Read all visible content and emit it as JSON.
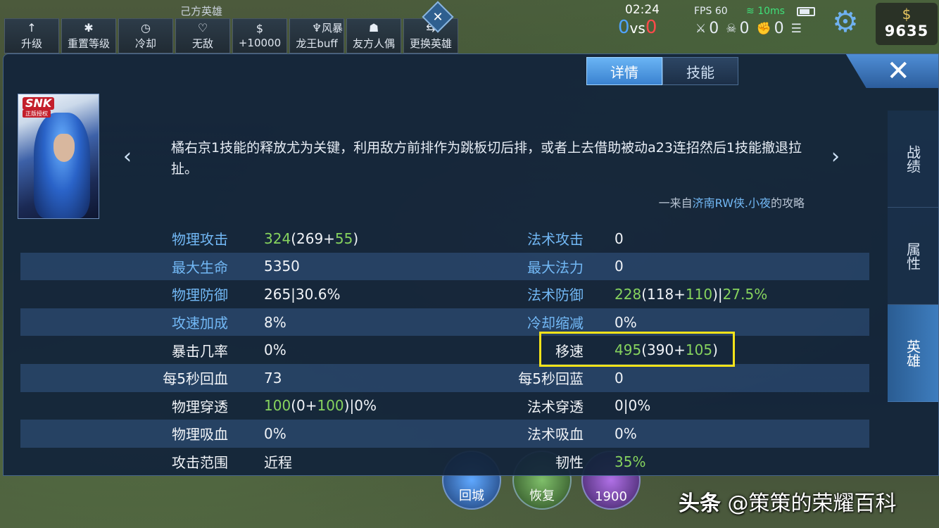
{
  "top_bar": {
    "side_label": "己方英雄",
    "buttons": [
      {
        "icon": "arrow-up-icon",
        "glyph": "↑",
        "label": "升级"
      },
      {
        "icon": "gear-icon",
        "glyph": "✱",
        "label": "重置等级"
      },
      {
        "icon": "clock-icon",
        "glyph": "◷",
        "label": "冷却"
      },
      {
        "icon": "heart-icon",
        "glyph": "♡",
        "label": "无敌"
      },
      {
        "icon": "coin-icon",
        "glyph": "$",
        "label": "+10000"
      },
      {
        "icon": "dragon-icon",
        "glyph": "♆",
        "label": "风暴",
        "label2": "龙王buff"
      },
      {
        "icon": "friend-icon",
        "glyph": "☗",
        "label": "友方人偶"
      },
      {
        "icon": "swap-icon",
        "glyph": "⇆",
        "label": "更换英雄"
      }
    ],
    "timer": "02:24",
    "score": {
      "blue": "0",
      "vs": "vs",
      "red": "0"
    },
    "fps": "FPS 60",
    "ping": "10ms",
    "kda": {
      "kills": "0",
      "deaths": "0",
      "assists": "0"
    },
    "gold": "9635"
  },
  "panel": {
    "tabs": [
      "详情",
      "技能"
    ],
    "active_tab": 0,
    "side_tabs": [
      "战绩",
      "属性",
      "英雄"
    ],
    "active_side_tab": 2,
    "portrait_badge": "SNK",
    "portrait_badge_sub": "正版授权",
    "tip": "橘右京1技能的释放尤为关键，利用敌方前排作为跳板切后排，或者上去借助被动a23连招然后1技能撤退拉扯。",
    "source_prefix": "一来自",
    "source_author": "济南RW侠.小夜",
    "source_suffix": "的攻略"
  },
  "stats": {
    "left": [
      {
        "label": "物理攻击",
        "label_color": "blue",
        "v1": "324",
        "v2": "(269+",
        "v3": "55",
        "v4": ")"
      },
      {
        "label": "最大生命",
        "label_color": "blue",
        "v1": "",
        "v2": "5350",
        "v3": "",
        "v4": ""
      },
      {
        "label": "物理防御",
        "label_color": "blue",
        "v1": "",
        "v2": "265|30.6%",
        "v3": "",
        "v4": ""
      },
      {
        "label": "攻速加成",
        "label_color": "blue",
        "v1": "",
        "v2": "8%",
        "v3": "",
        "v4": ""
      },
      {
        "label": "暴击几率",
        "label_color": "white",
        "v1": "",
        "v2": "0%",
        "v3": "",
        "v4": ""
      },
      {
        "label": "每5秒回血",
        "label_color": "white",
        "v1": "",
        "v2": "73",
        "v3": "",
        "v4": ""
      },
      {
        "label": "物理穿透",
        "label_color": "white",
        "v1": "100",
        "v2": "(0+",
        "v3": "100",
        "v4": ")|0%"
      },
      {
        "label": "物理吸血",
        "label_color": "white",
        "v1": "",
        "v2": "0%",
        "v3": "",
        "v4": ""
      },
      {
        "label": "攻击范围",
        "label_color": "white",
        "v1": "",
        "v2": "近程",
        "v3": "",
        "v4": ""
      }
    ],
    "right": [
      {
        "label": "法术攻击",
        "label_color": "blue",
        "v1": "",
        "v2": "0",
        "v3": "",
        "v4": ""
      },
      {
        "label": "最大法力",
        "label_color": "blue",
        "v1": "",
        "v2": "0",
        "v3": "",
        "v4": ""
      },
      {
        "label": "法术防御",
        "label_color": "blue",
        "v1": "228",
        "v2": "(118+",
        "v3": "110",
        "v4": ")|",
        "v5": "27.5%"
      },
      {
        "label": "冷却缩减",
        "label_color": "blue",
        "v1": "",
        "v2": "0%",
        "v3": "",
        "v4": ""
      },
      {
        "label": "移速",
        "label_color": "white",
        "v1": "495",
        "v2": "(390+",
        "v3": "105",
        "v4": ")"
      },
      {
        "label": "每5秒回蓝",
        "label_color": "white",
        "v1": "",
        "v2": "0",
        "v3": "",
        "v4": ""
      },
      {
        "label": "法术穿透",
        "label_color": "white",
        "v1": "",
        "v2": "0|0%",
        "v3": "",
        "v4": ""
      },
      {
        "label": "法术吸血",
        "label_color": "white",
        "v1": "",
        "v2": "0%",
        "v3": "",
        "v4": ""
      },
      {
        "label": "韧性",
        "label_color": "white",
        "v1": "35%",
        "v2": "",
        "v3": "",
        "v4": ""
      }
    ]
  },
  "bottom": {
    "recall": "回城",
    "heal": "恢复",
    "item_price": "1900"
  },
  "watermark": {
    "prefix": "头条",
    "text": "@策策的荣耀百科"
  },
  "colors": {
    "label_blue": "#72b8f5",
    "green_value": "#86d35e",
    "highlight_yellow": "#f6e31a",
    "tab_active": "#4a96e0"
  }
}
